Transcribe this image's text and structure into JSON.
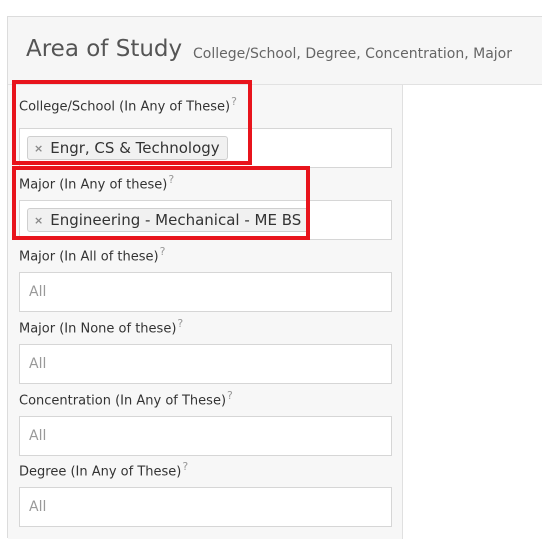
{
  "header": {
    "title": "Area of Study",
    "subtitle": "College/School, Degree, Concentration, Major"
  },
  "fields": [
    {
      "label": "College/School (In Any of These)",
      "help": "?",
      "token": "Engr, CS & Technology",
      "placeholder": ""
    },
    {
      "label": "Major (In Any of these)",
      "help": "?",
      "token": "Engineering - Mechanical - ME BS",
      "placeholder": ""
    },
    {
      "label": "Major (In All of these)",
      "help": "?",
      "placeholder": "All"
    },
    {
      "label": "Major (In None of these)",
      "help": "?",
      "placeholder": "All"
    },
    {
      "label": "Concentration (In Any of These)",
      "help": "?",
      "placeholder": "All"
    },
    {
      "label": "Degree (In Any of These)",
      "help": "?",
      "placeholder": "All"
    }
  ],
  "icons": {
    "remove_token": "×"
  },
  "colors": {
    "highlight": "#e8141c"
  }
}
